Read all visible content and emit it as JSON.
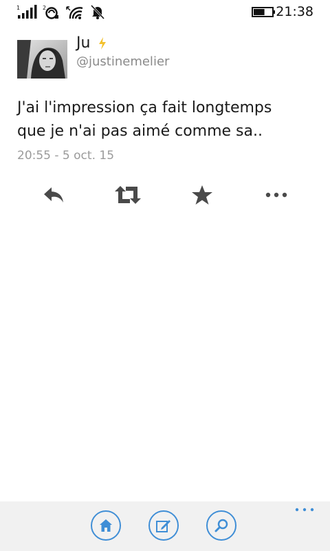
{
  "status_bar": {
    "time": "21:38",
    "sim1_label": "1",
    "sim2_label": "2",
    "icons": [
      "signal-sim1-icon",
      "signal-sim2-icon",
      "wifi-icon",
      "mute-icon",
      "battery-icon"
    ],
    "battery_level": 0.6
  },
  "tweet": {
    "display_name": "Ju",
    "username": "@justinemelier",
    "text": "J'ai l'impression ça fait longtemps\nque je n'ai pas aimé comme sa..",
    "timestamp": "20:55 - 5 oct. 15",
    "actions": [
      "reply-icon",
      "retweet-icon",
      "favorite-star-icon",
      "more-options-icon"
    ]
  },
  "app_bar": {
    "buttons": [
      "home-icon",
      "compose-icon",
      "search-icon"
    ],
    "more": "more-icon",
    "accent_color": "#3f8ed6",
    "background": "#f1f1f1"
  },
  "colors": {
    "text": "#1a1a1a",
    "muted": "#9a9a9a",
    "action_icon": "#4a4a4a",
    "verified_bolt": "#f2c12e"
  }
}
